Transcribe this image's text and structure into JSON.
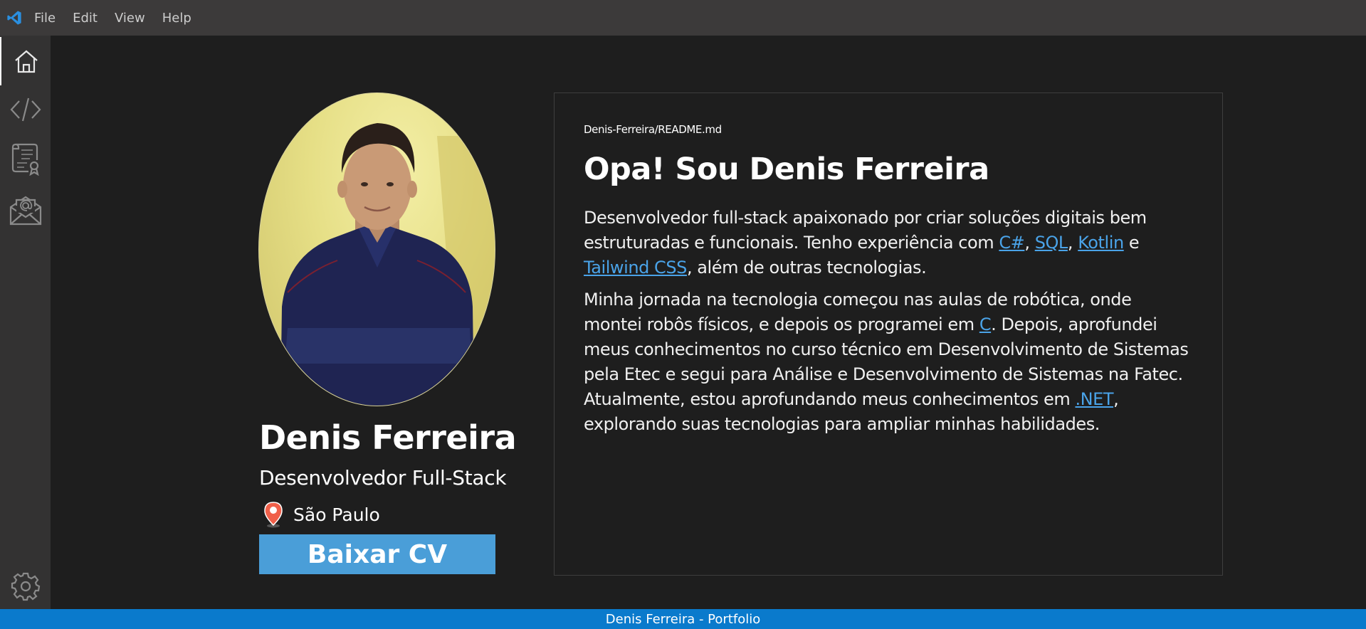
{
  "menu": [
    "File",
    "Edit",
    "View",
    "Help"
  ],
  "activity_bar": [
    {
      "icon": "home-icon",
      "active": true
    },
    {
      "icon": "code-icon",
      "active": false
    },
    {
      "icon": "certificate-icon",
      "active": false
    },
    {
      "icon": "mail-icon",
      "active": false
    },
    {
      "icon": "gear-icon",
      "active": false
    }
  ],
  "profile": {
    "name": "Denis Ferreira",
    "role": "Desenvolvedor Full-Stack",
    "location": "São Paulo",
    "cv_button": "Baixar CV"
  },
  "readme": {
    "path": "Denis-Ferreira/README.md",
    "title": "Opa! Sou Denis Ferreira",
    "p1": {
      "t1": "Desenvolvedor full-stack apaixonado por criar soluções digitais bem estruturadas e funcionais. Tenho experiência com ",
      "l1": "C#",
      "t2": ", ",
      "l2": "SQL",
      "t3": ", ",
      "l3": "Kotlin",
      "t4": " e ",
      "l4": "Tailwind CSS",
      "t5": ", além de outras tecnologias."
    },
    "p2": {
      "t1": "Minha jornada na tecnologia começou nas aulas de robótica, onde montei robôs físicos, e depois os programei em ",
      "l1": "C",
      "t2": ". Depois, aprofundei meus conhecimentos no curso técnico em Desenvolvimento de Sistemas pela Etec e segui para Análise e Desenvolvimento de Sistemas na Fatec. Atualmente, estou aprofundando meus conhecimentos em ",
      "l2": ".NET",
      "t3": ", explorando suas tecnologias para ampliar minhas habilidades."
    }
  },
  "status_bar": "Denis Ferreira - Portfolio",
  "colors": {
    "accent": "#0a7acc",
    "button": "#4a9ed8",
    "link": "#4aa3e8",
    "background": "#1e1e1e"
  }
}
